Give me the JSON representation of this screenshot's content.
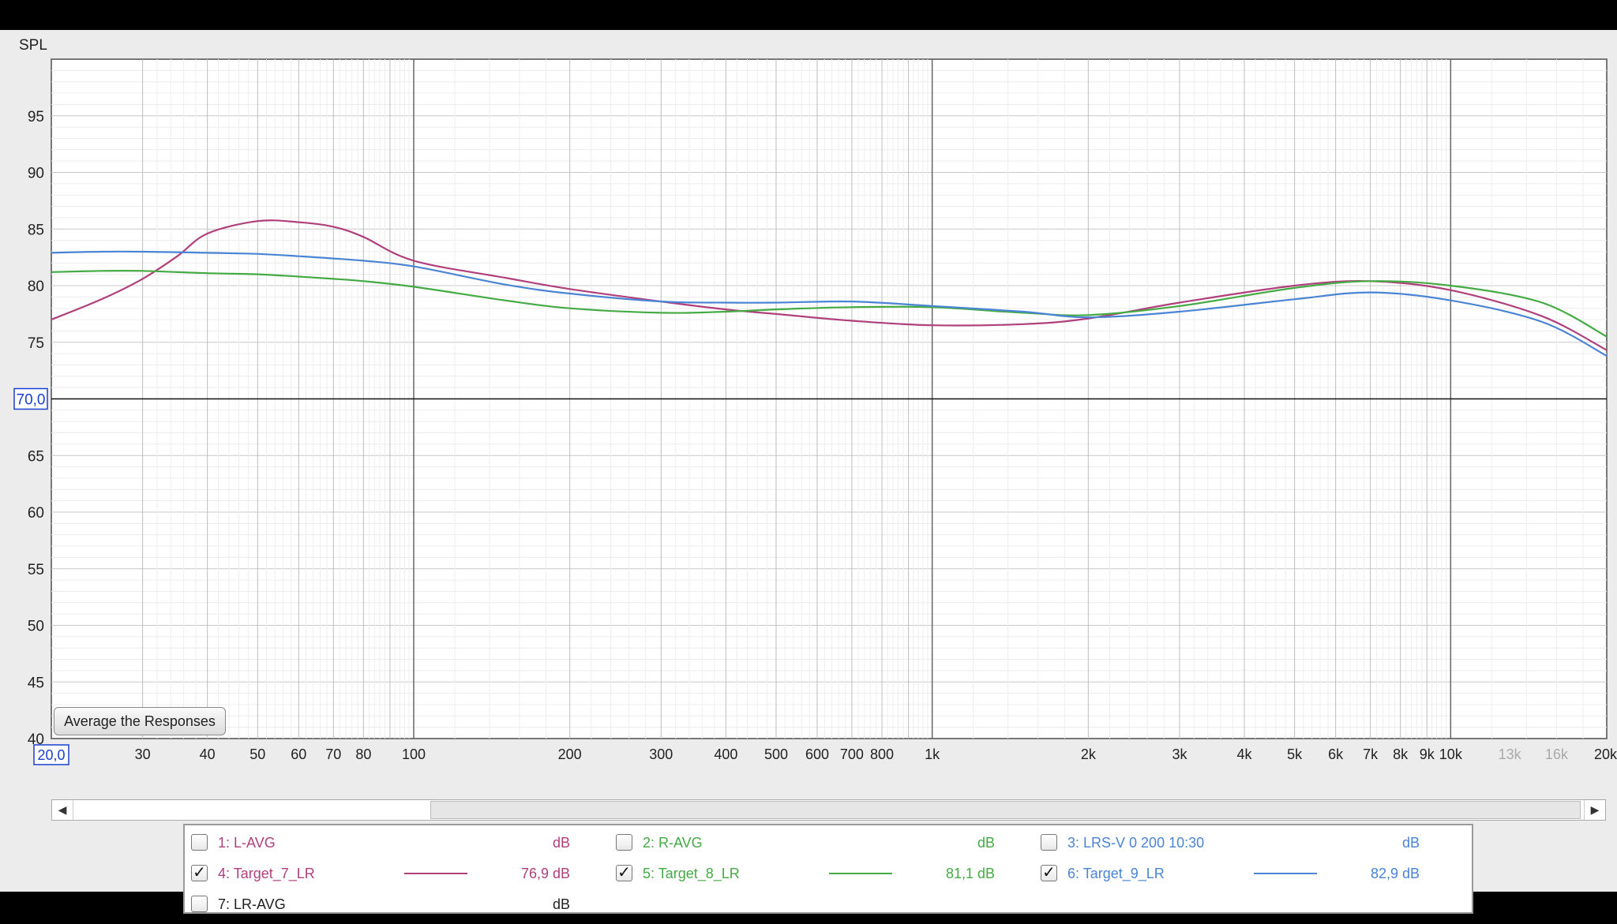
{
  "colors": {
    "magenta": "#b0407c",
    "green": "#44ab44",
    "blue": "#4a84d4",
    "black": "#222222"
  },
  "chart_data": {
    "type": "line",
    "title": "",
    "ylabel": "SPL",
    "xlabel": "",
    "x_scale": "log",
    "xlim": [
      20,
      20000
    ],
    "ylim": [
      40,
      100
    ],
    "y_ticks": [
      40,
      45,
      50,
      55,
      60,
      65,
      75,
      80,
      85,
      90,
      95
    ],
    "y_marker": "70,0",
    "x_marker": "20,0",
    "x_ticks": [
      {
        "v": 30,
        "t": "30"
      },
      {
        "v": 40,
        "t": "40"
      },
      {
        "v": 50,
        "t": "50"
      },
      {
        "v": 60,
        "t": "60"
      },
      {
        "v": 70,
        "t": "70"
      },
      {
        "v": 80,
        "t": "80"
      },
      {
        "v": 100,
        "t": "100"
      },
      {
        "v": 200,
        "t": "200"
      },
      {
        "v": 300,
        "t": "300"
      },
      {
        "v": 400,
        "t": "400"
      },
      {
        "v": 500,
        "t": "500"
      },
      {
        "v": 600,
        "t": "600"
      },
      {
        "v": 700,
        "t": "700"
      },
      {
        "v": 800,
        "t": "800"
      },
      {
        "v": 1000,
        "t": "1k"
      },
      {
        "v": 2000,
        "t": "2k"
      },
      {
        "v": 3000,
        "t": "3k"
      },
      {
        "v": 4000,
        "t": "4k"
      },
      {
        "v": 5000,
        "t": "5k"
      },
      {
        "v": 6000,
        "t": "6k"
      },
      {
        "v": 7000,
        "t": "7k"
      },
      {
        "v": 8000,
        "t": "8k"
      },
      {
        "v": 9000,
        "t": "9k"
      },
      {
        "v": 10000,
        "t": "10k"
      },
      {
        "v": 13000,
        "t": "13k",
        "dim": true
      },
      {
        "v": 16000,
        "t": "16k",
        "dim": true
      },
      {
        "v": 20000,
        "t": "20kHz"
      }
    ],
    "series": [
      {
        "name": "4: Target_7_LR",
        "color": "#b0407c",
        "x": [
          20,
          25,
          30,
          35,
          40,
          50,
          60,
          70,
          80,
          100,
          150,
          200,
          300,
          400,
          500,
          700,
          1000,
          1500,
          2000,
          3000,
          5000,
          7000,
          10000,
          15000,
          20000
        ],
        "y": [
          77,
          78.8,
          80.6,
          82.6,
          84.6,
          85.7,
          85.6,
          85.2,
          84.3,
          82.2,
          80.7,
          79.7,
          78.6,
          77.9,
          77.5,
          76.9,
          76.5,
          76.6,
          77.1,
          78.5,
          80,
          80.4,
          79.6,
          77.3,
          74.3
        ]
      },
      {
        "name": "5: Target_8_LR",
        "color": "#44ab44",
        "x": [
          20,
          25,
          30,
          40,
          50,
          60,
          70,
          80,
          100,
          150,
          200,
          300,
          400,
          500,
          700,
          1000,
          1500,
          2000,
          3000,
          5000,
          7000,
          10000,
          15000,
          20000
        ],
        "y": [
          81.2,
          81.3,
          81.3,
          81.1,
          81,
          80.8,
          80.6,
          80.4,
          79.9,
          78.7,
          78,
          77.6,
          77.7,
          77.9,
          78.1,
          78.1,
          77.6,
          77.4,
          78.2,
          79.8,
          80.4,
          80,
          78.5,
          75.5
        ]
      },
      {
        "name": "6: Target_9_LR",
        "color": "#4a84d4",
        "x": [
          20,
          25,
          30,
          40,
          50,
          60,
          70,
          80,
          100,
          150,
          200,
          300,
          400,
          500,
          700,
          1000,
          1500,
          2000,
          3000,
          5000,
          7000,
          10000,
          15000,
          20000
        ],
        "y": [
          82.9,
          83,
          83,
          82.9,
          82.8,
          82.6,
          82.4,
          82.2,
          81.7,
          80.1,
          79.3,
          78.6,
          78.5,
          78.5,
          78.6,
          78.2,
          77.7,
          77.2,
          77.7,
          78.8,
          79.4,
          78.7,
          76.8,
          73.8
        ]
      }
    ]
  },
  "button": {
    "average": "Average the Responses"
  },
  "scrollbar": {
    "left": "◀",
    "right": "▶"
  },
  "legend": [
    {
      "checked": false,
      "mark": "",
      "name": "1: L-AVG",
      "value": "dB",
      "color": "#b0407c",
      "line": false
    },
    {
      "checked": false,
      "mark": "",
      "name": "2: R-AVG",
      "value": "dB",
      "color": "#44ab44",
      "line": false
    },
    {
      "checked": false,
      "mark": "",
      "name": "3: LRS-V 0 200 10:30",
      "value": "dB",
      "color": "#4a84d4",
      "line": false
    },
    {
      "checked": true,
      "mark": "✓",
      "name": "4: Target_7_LR",
      "value": "76,9 dB",
      "color": "#b0407c",
      "line": true
    },
    {
      "checked": true,
      "mark": "✓",
      "name": "5: Target_8_LR",
      "value": "81,1 dB",
      "color": "#44ab44",
      "line": true
    },
    {
      "checked": true,
      "mark": "✓",
      "name": "6: Target_9_LR",
      "value": "82,9 dB",
      "color": "#4a84d4",
      "line": true
    },
    {
      "checked": false,
      "mark": "",
      "name": "7: LR-AVG",
      "value": "dB",
      "color": "#222222",
      "line": false
    }
  ]
}
